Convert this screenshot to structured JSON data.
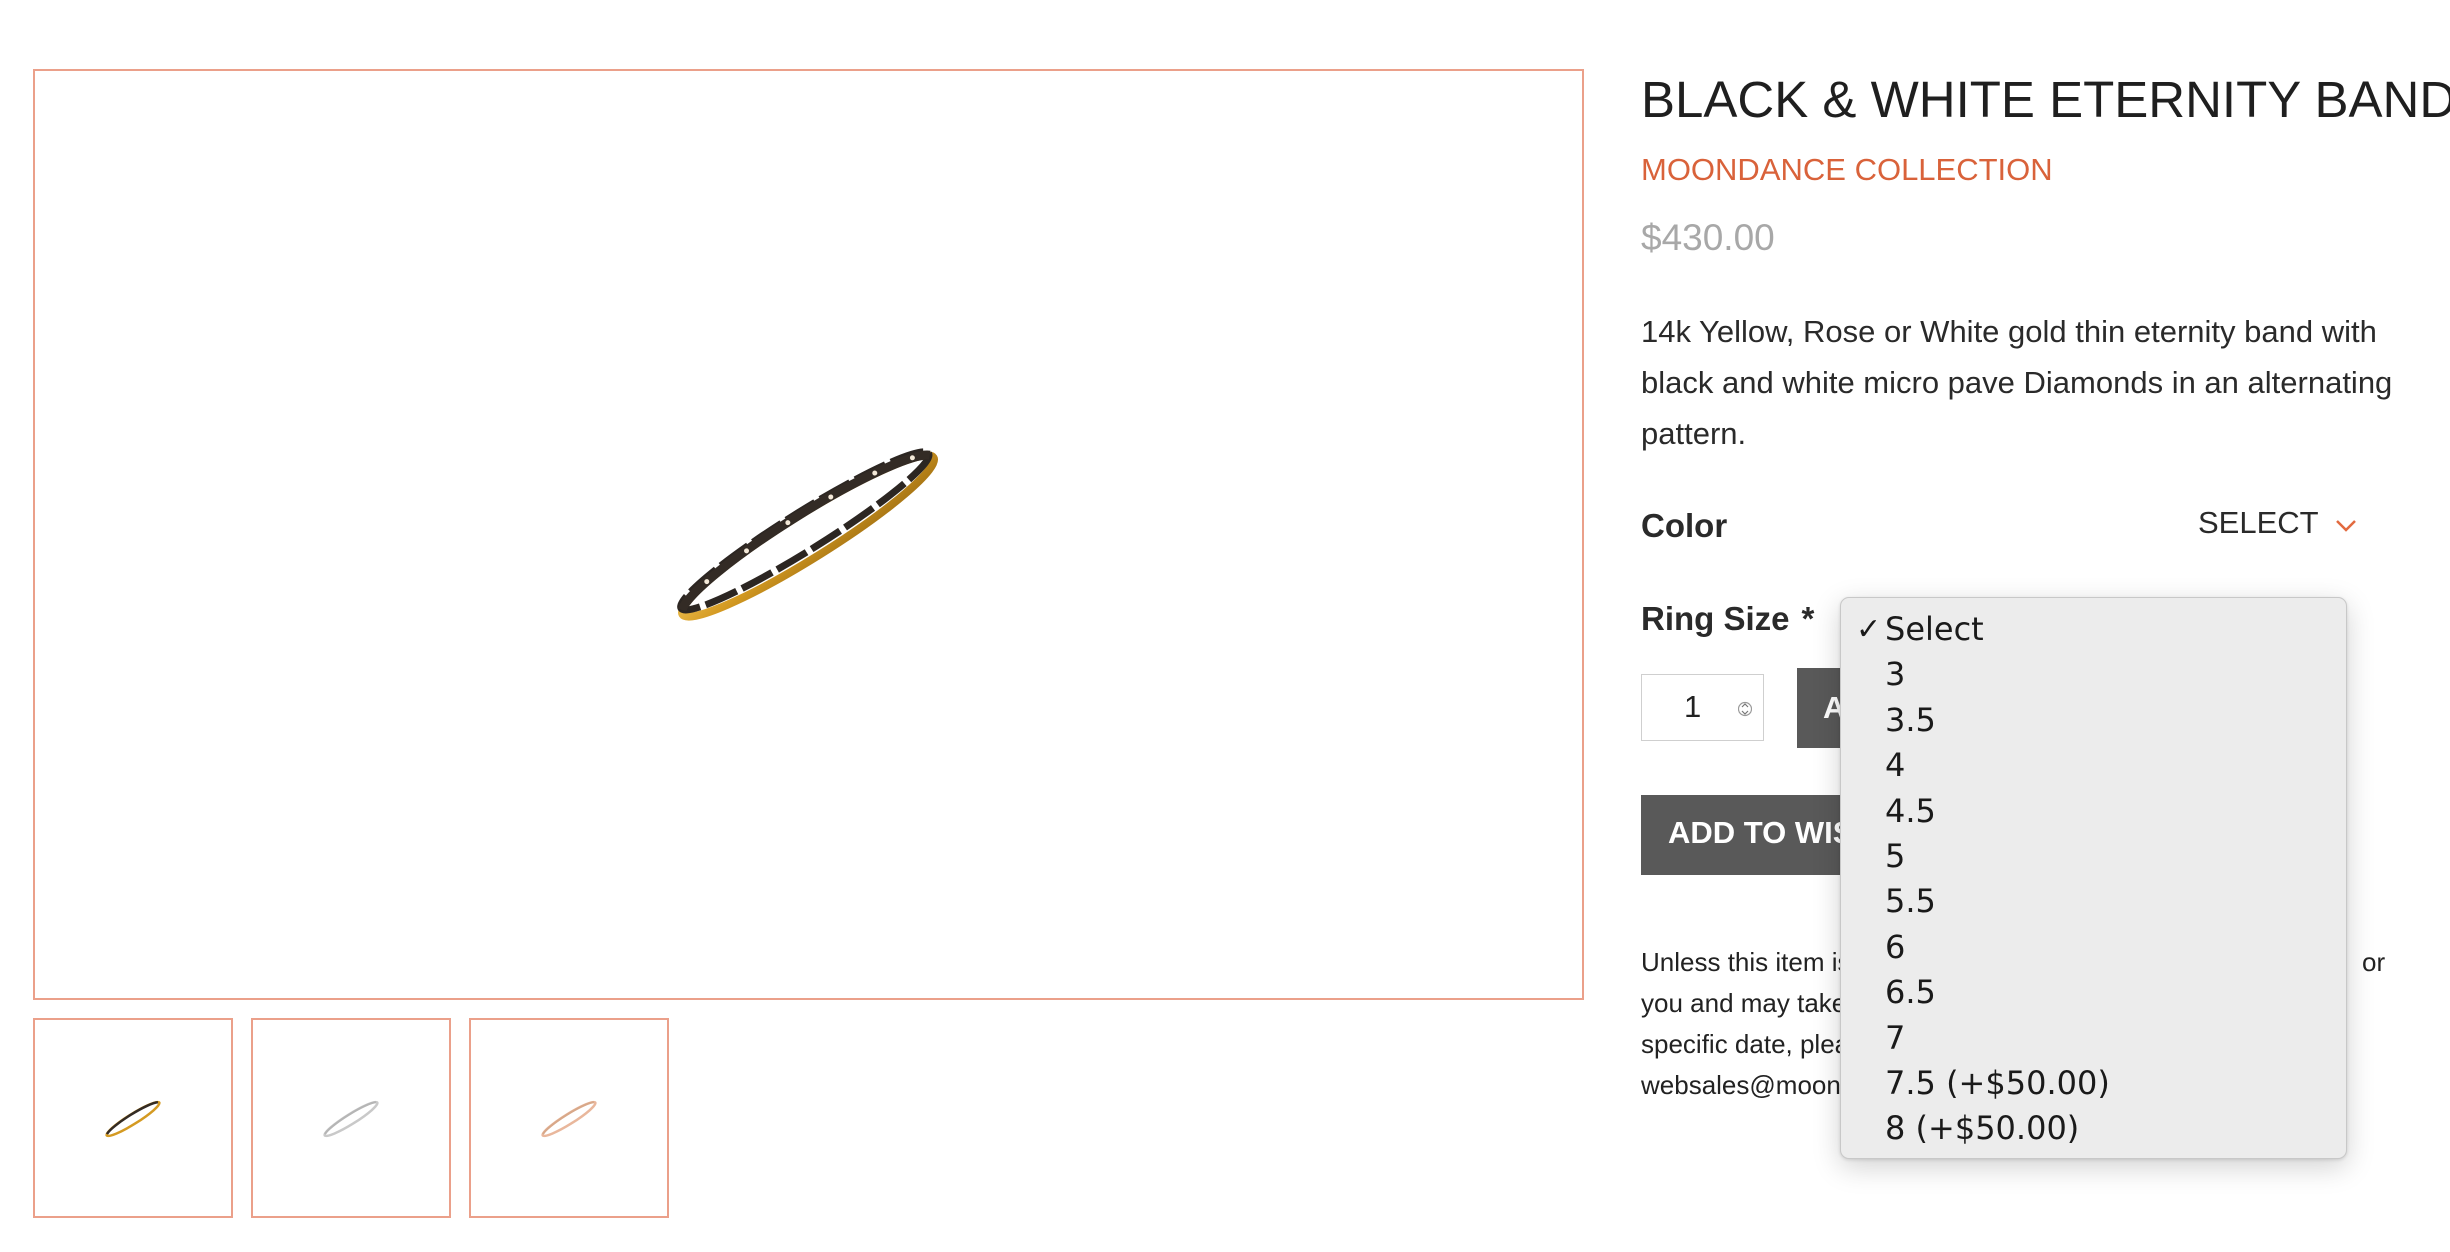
{
  "product": {
    "title": "BLACK & WHITE ETERNITY BAND",
    "collection": "MOONDANCE COLLECTION",
    "price": "$430.00",
    "description": "14k Yellow, Rose or White gold thin eternity band with black and white micro pave Diamonds in an alternating pattern."
  },
  "gallery": {
    "thumbnails": [
      {
        "alt": "yellow gold band"
      },
      {
        "alt": "white gold band"
      },
      {
        "alt": "rose gold band"
      }
    ]
  },
  "options": {
    "color": {
      "label": "Color",
      "selected": "SELECT",
      "icon": "chevron-down-icon"
    },
    "ring_size": {
      "label": "Ring Size",
      "required_marker": "*"
    }
  },
  "cart": {
    "quantity": "1",
    "add_to_cart_label": "A",
    "add_to_wishlist_label": "ADD TO WISH"
  },
  "notice": {
    "lines": [
      "Unless this item is",
      "you and may take",
      "specific date, plea",
      "websales@moonc"
    ],
    "trailing_fragment": "or"
  },
  "ring_size_dropdown": {
    "checkmark": "✓",
    "options": [
      "Select",
      "3",
      "3.5",
      "4",
      "4.5",
      "5",
      "5.5",
      "6",
      "6.5",
      "7",
      "7.5 (+$50.00)",
      "8 (+$50.00)"
    ],
    "selected_index": 0
  },
  "colors": {
    "accent": "#d9623a",
    "border_accent": "#eba08a",
    "button_bg": "#595959",
    "price": "#a8a8a8"
  }
}
